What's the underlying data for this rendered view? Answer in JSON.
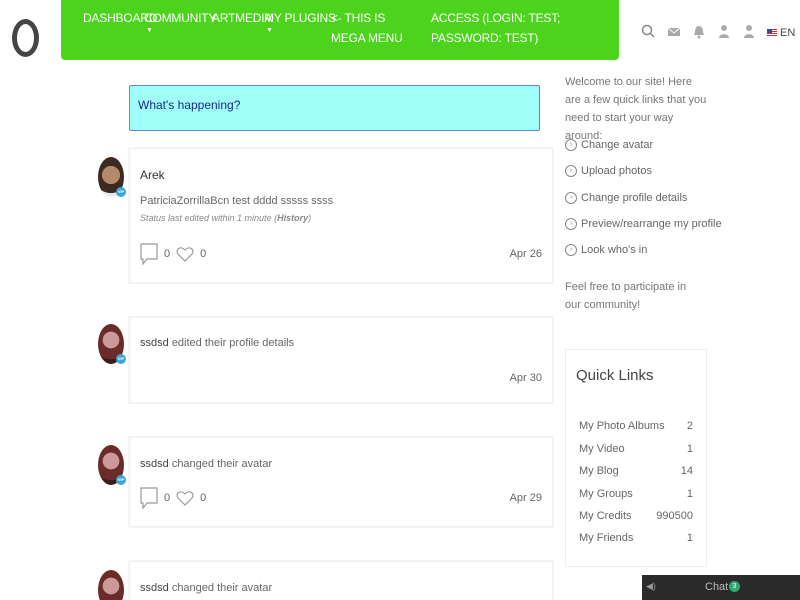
{
  "nav": {
    "items": [
      {
        "label": "DASHBOARD"
      },
      {
        "label": "COMMUNITY"
      },
      {
        "label": "ARTMEDIA"
      },
      {
        "label": "MY PLUGINS"
      },
      {
        "label": "<- THIS IS MEGA MENU"
      },
      {
        "label": "ACCESS (LOGIN: TEST; PASSWORD: TEST)"
      }
    ],
    "lang": "EN",
    "accent": "#4cd41c"
  },
  "composer": {
    "placeholder": "What's happening?"
  },
  "activity": [
    {
      "author": "Arek",
      "text": "PatriciaZorrillaBcn test dddd sssss ssss",
      "status_prefix": "Status last edited within 1 minute (",
      "status_link": "History",
      "status_suffix": ")",
      "comments": "0",
      "likes": "0",
      "date": "Apr 26"
    },
    {
      "author": "ssdsd",
      "text": "edited their profile details",
      "date": "Apr 30"
    },
    {
      "author": "ssdsd",
      "text": "changed their avatar",
      "comments": "0",
      "likes": "0",
      "date": "Apr 29"
    },
    {
      "author": "ssdsd",
      "text": "changed their avatar"
    }
  ],
  "sidebar": {
    "welcome": "Welcome to our site! Here are a few quick links that you need to start your way around:",
    "links": [
      {
        "label": "Change avatar"
      },
      {
        "label": "Upload photos"
      },
      {
        "label": "Change profile details"
      },
      {
        "label": "Preview/rearrange my profile"
      },
      {
        "label": "Look who's in"
      }
    ],
    "feel_free": "Feel free to participate in our community!",
    "quick_links": {
      "title": "Quick Links",
      "rows": [
        {
          "label": "My Photo Albums",
          "value": "2"
        },
        {
          "label": "My Video",
          "value": "1"
        },
        {
          "label": "My Blog",
          "value": "14"
        },
        {
          "label": "My Groups",
          "value": "1"
        },
        {
          "label": "My Credits",
          "value": "990500"
        },
        {
          "label": "My Friends",
          "value": "1"
        }
      ]
    }
  },
  "chat": {
    "label": "Chat",
    "count": "3"
  }
}
